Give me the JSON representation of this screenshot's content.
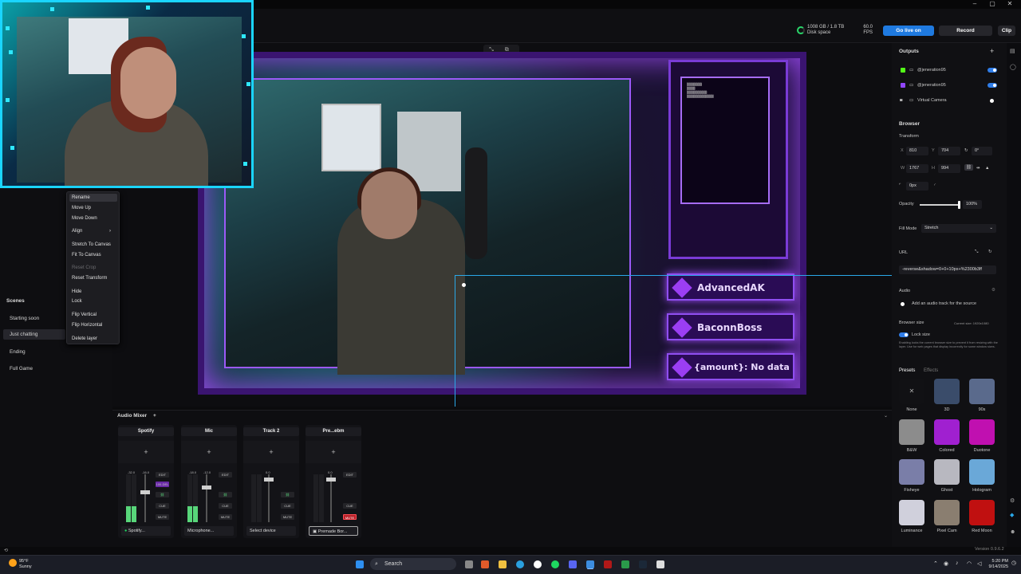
{
  "window": {
    "minimize": "–",
    "maximize": "▢",
    "close": "✕"
  },
  "topbar": {
    "disk_used": "1008 GB / 1.8 TB",
    "disk_label": "Disk space",
    "fps_value": "60.0",
    "fps_label": "FPS",
    "go_live": "Go live on",
    "record": "Record",
    "clip": "Clip"
  },
  "scenes": {
    "title": "Scenes",
    "items": [
      "Starting soon",
      "Just chatting",
      "Ending",
      "Full Game"
    ],
    "active": "Just chatting"
  },
  "context_menu": {
    "items": [
      {
        "label": "Rename",
        "state": "highlighted"
      },
      {
        "label": "Move Up"
      },
      {
        "label": "Move Down"
      },
      {
        "label": "Align",
        "submenu": "›"
      },
      {
        "label": "Stretch To Canvas"
      },
      {
        "label": "Fit To Canvas"
      },
      {
        "label": "Reset Crop",
        "state": "disabled"
      },
      {
        "label": "Reset Transform"
      },
      {
        "label": "Hide"
      },
      {
        "label": "Lock"
      },
      {
        "label": "Flip Vertical"
      },
      {
        "label": "Flip Horizontal"
      },
      {
        "label": "Delete layer"
      }
    ]
  },
  "canvas": {
    "names": [
      "AdvancedAK",
      "BaconnBoss",
      "{amount}: No data"
    ],
    "tools": "⤡ ⧉ ◌"
  },
  "mixer": {
    "title": "Audio Mixer",
    "add": "+",
    "tracks": [
      {
        "name": "Spotify",
        "db_left": "-32.0",
        "db_right": "-16.0",
        "device": "Spotify...",
        "level": 0.35,
        "edit": "EDIT",
        "extra": "100-DEL",
        "cue": "CUE",
        "mute": "MUTE"
      },
      {
        "name": "Mic",
        "db_left": "-18.0",
        "db_right": "-12.0",
        "device": "Microphone...",
        "level": 0.35,
        "edit": "EDIT",
        "cue": "CUE",
        "mute": "MUTE"
      },
      {
        "name": "Track 2",
        "db_left": "",
        "db_right": "0.0",
        "device": "Select device",
        "level": 0,
        "edit": "EDIT",
        "cue": "CUE",
        "mute": "MUTE"
      },
      {
        "name": "Pre...ebm",
        "db_left": "",
        "db_right": "0.0",
        "device": "Premade Bor...",
        "level": 0,
        "edit": "EDIT",
        "cue": "CUE",
        "mute": "MUTE",
        "muted": true
      }
    ]
  },
  "outputs": {
    "title": "Outputs",
    "items": [
      {
        "label": "@jeneration95",
        "color": "#53fc18"
      },
      {
        "label": "@jeneration95",
        "color": "#9146ff"
      },
      {
        "label": "Virtual Camera",
        "color": "#cccccc"
      }
    ]
  },
  "browser": {
    "title": "Browser",
    "transform": "Transform",
    "x_label": "X",
    "x": "810",
    "y_label": "Y",
    "y": "704",
    "rot": "0°",
    "w_label": "W",
    "w": "1767",
    "h_label": "H",
    "h": "994",
    "radius": "0px",
    "opacity_label": "Opacity",
    "opacity": "100%",
    "fill_label": "Fill Mode",
    "fill": "Stretch",
    "url_label": "URL",
    "url": "-reverse&shadow=0+0+10px+%2300b3ff",
    "audio_label": "Audio",
    "audio_text": "Add an audio track for the source",
    "size_label": "Browser size",
    "size_current": "Current size: 1920x1080",
    "lock_size": "Lock size",
    "lock_desc": "Enabling locks the current browser size to prevent it from resizing with the layer. Use for web pages that display incorrectly for some window sizes."
  },
  "presets": {
    "tab_presets": "Presets",
    "tab_effects": "Effects",
    "items": [
      {
        "label": "None",
        "color": "#111114"
      },
      {
        "label": "3D",
        "color": "#3a4c6a"
      },
      {
        "label": "90s",
        "color": "#5a6a8c"
      },
      {
        "label": "B&W",
        "color": "#8c8c8c"
      },
      {
        "label": "Colored",
        "color": "#a020d0"
      },
      {
        "label": "Duotone",
        "color": "#c010b0"
      },
      {
        "label": "Fisheye",
        "color": "#7a7ea8"
      },
      {
        "label": "Ghost",
        "color": "#b8b8c0"
      },
      {
        "label": "Hologram",
        "color": "#6aa8d8"
      },
      {
        "label": "Luminance",
        "color": "#d0d0dc"
      },
      {
        "label": "Pixel Cam",
        "color": "#8a7e70"
      },
      {
        "label": "Red Moon",
        "color": "#c01010"
      }
    ]
  },
  "version": "Version 0.9.6.2",
  "taskbar": {
    "weather_temp": "95°F",
    "weather_desc": "Sunny",
    "search": "Search",
    "time": "5:20 PM",
    "date": "9/14/2025"
  }
}
